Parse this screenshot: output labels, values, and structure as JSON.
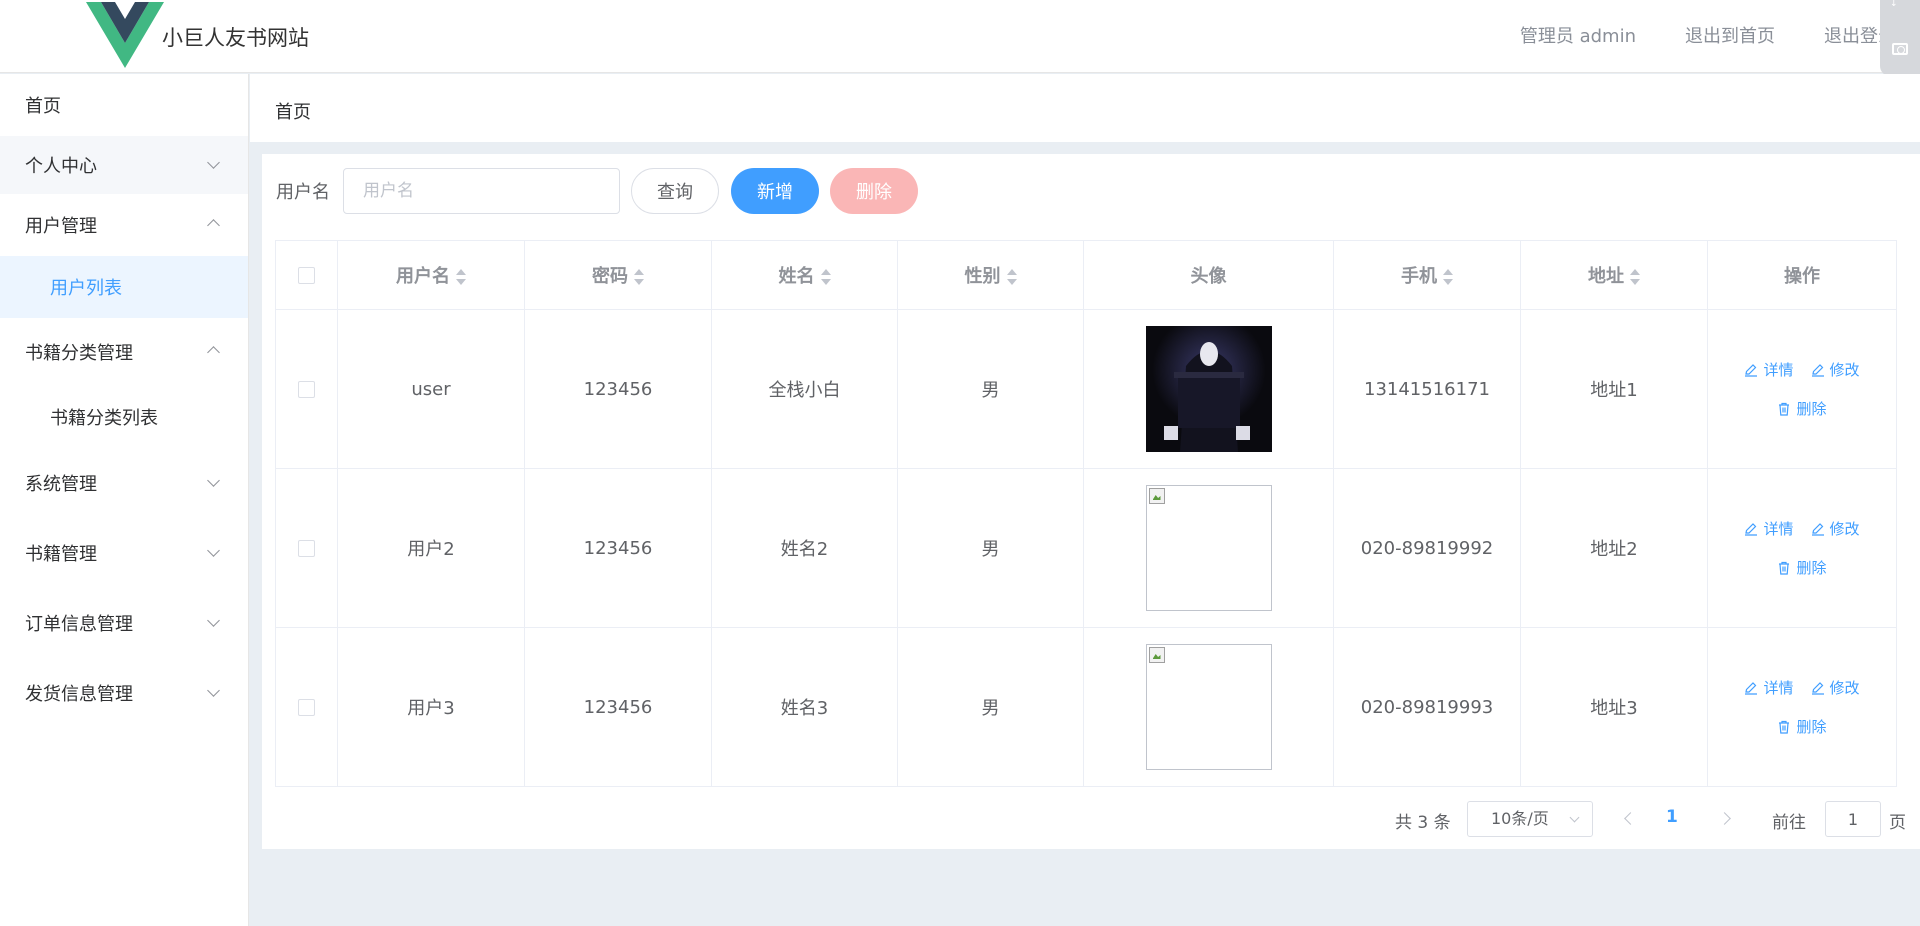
{
  "header": {
    "site_title": "小巨人友书网站",
    "admin_label": "管理员 admin",
    "back_home": "退出到首页",
    "logout": "退出登录"
  },
  "sidebar": {
    "items": [
      {
        "label": "首页"
      },
      {
        "label": "个人中心"
      },
      {
        "label": "用户管理"
      },
      {
        "label": "用户列表"
      },
      {
        "label": "书籍分类管理"
      },
      {
        "label": "书籍分类列表"
      },
      {
        "label": "系统管理"
      },
      {
        "label": "书籍管理"
      },
      {
        "label": "订单信息管理"
      },
      {
        "label": "发货信息管理"
      }
    ]
  },
  "breadcrumb": "首页",
  "search": {
    "label": "用户名",
    "placeholder": "用户名",
    "value": "",
    "query_label": "查询",
    "add_label": "新增",
    "delete_label": "删除"
  },
  "table": {
    "headers": {
      "username": "用户名",
      "password": "密码",
      "name": "姓名",
      "gender": "性别",
      "avatar": "头像",
      "phone": "手机",
      "address": "地址",
      "actions": "操作"
    },
    "rows": [
      {
        "username": "user",
        "password": "123456",
        "name": "全栈小白",
        "gender": "男",
        "phone": "13141516171",
        "address": "地址1",
        "avatar": "photo"
      },
      {
        "username": "用户2",
        "password": "123456",
        "name": "姓名2",
        "gender": "男",
        "phone": "020-89819992",
        "address": "地址2",
        "avatar": "broken"
      },
      {
        "username": "用户3",
        "password": "123456",
        "name": "姓名3",
        "gender": "男",
        "phone": "020-89819993",
        "address": "地址3",
        "avatar": "broken"
      }
    ],
    "actions": {
      "detail": "详情",
      "edit": "修改",
      "delete": "删除"
    }
  },
  "pagination": {
    "total": "共 3 条",
    "page_size": "10条/页",
    "current_page": "1",
    "goto_label": "前往",
    "goto_value": "1",
    "page_suffix": "页"
  },
  "colors": {
    "primary": "#409eff",
    "danger_disabled": "#fab6b6",
    "logo_green": "#41b883",
    "logo_dark": "#34495e"
  }
}
